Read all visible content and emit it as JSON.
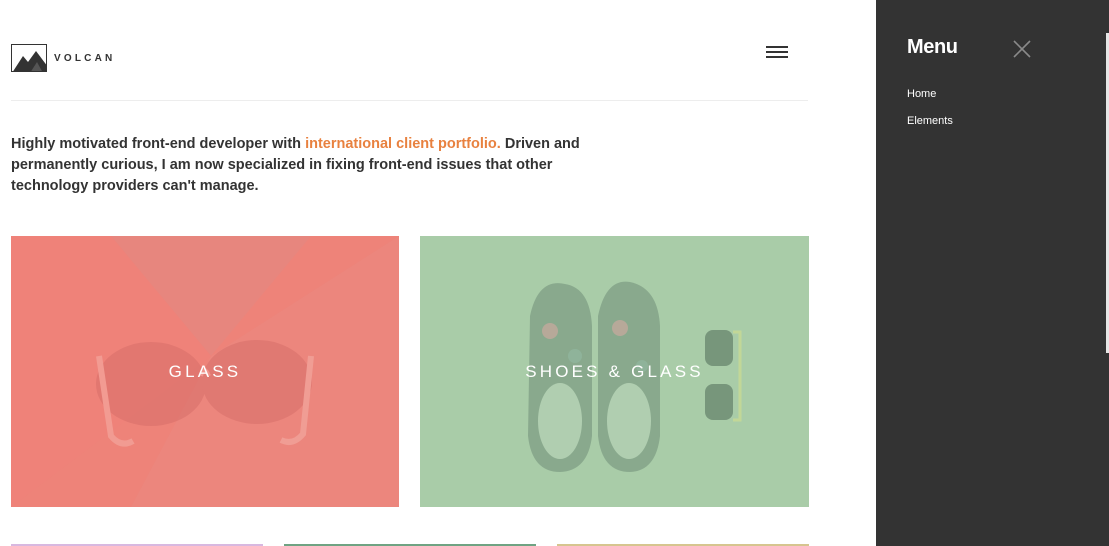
{
  "brand": {
    "name": "VOLCAN",
    "logo_icon": "mountain-logo-icon"
  },
  "header": {
    "menu_icon": "hamburger-icon"
  },
  "intro": {
    "text_before": "Highly motivated front-end developer with ",
    "highlight": "international client portfolio.",
    "text_after": " Driven and permanently curious, I am now specialized in fixing front-end issues that other technology providers can't manage."
  },
  "tiles": [
    {
      "label": "GLASS",
      "bg_color": "#ee8379"
    },
    {
      "label": "SHOES & GLASS",
      "bg_color": "#a9cca8"
    }
  ],
  "side_menu": {
    "title": "Menu",
    "close_icon": "close-icon",
    "items": [
      {
        "label": "Home"
      },
      {
        "label": "Elements"
      }
    ]
  },
  "colors": {
    "accent": "#e8813f",
    "text": "#333333",
    "menu_bg": "#333333"
  }
}
